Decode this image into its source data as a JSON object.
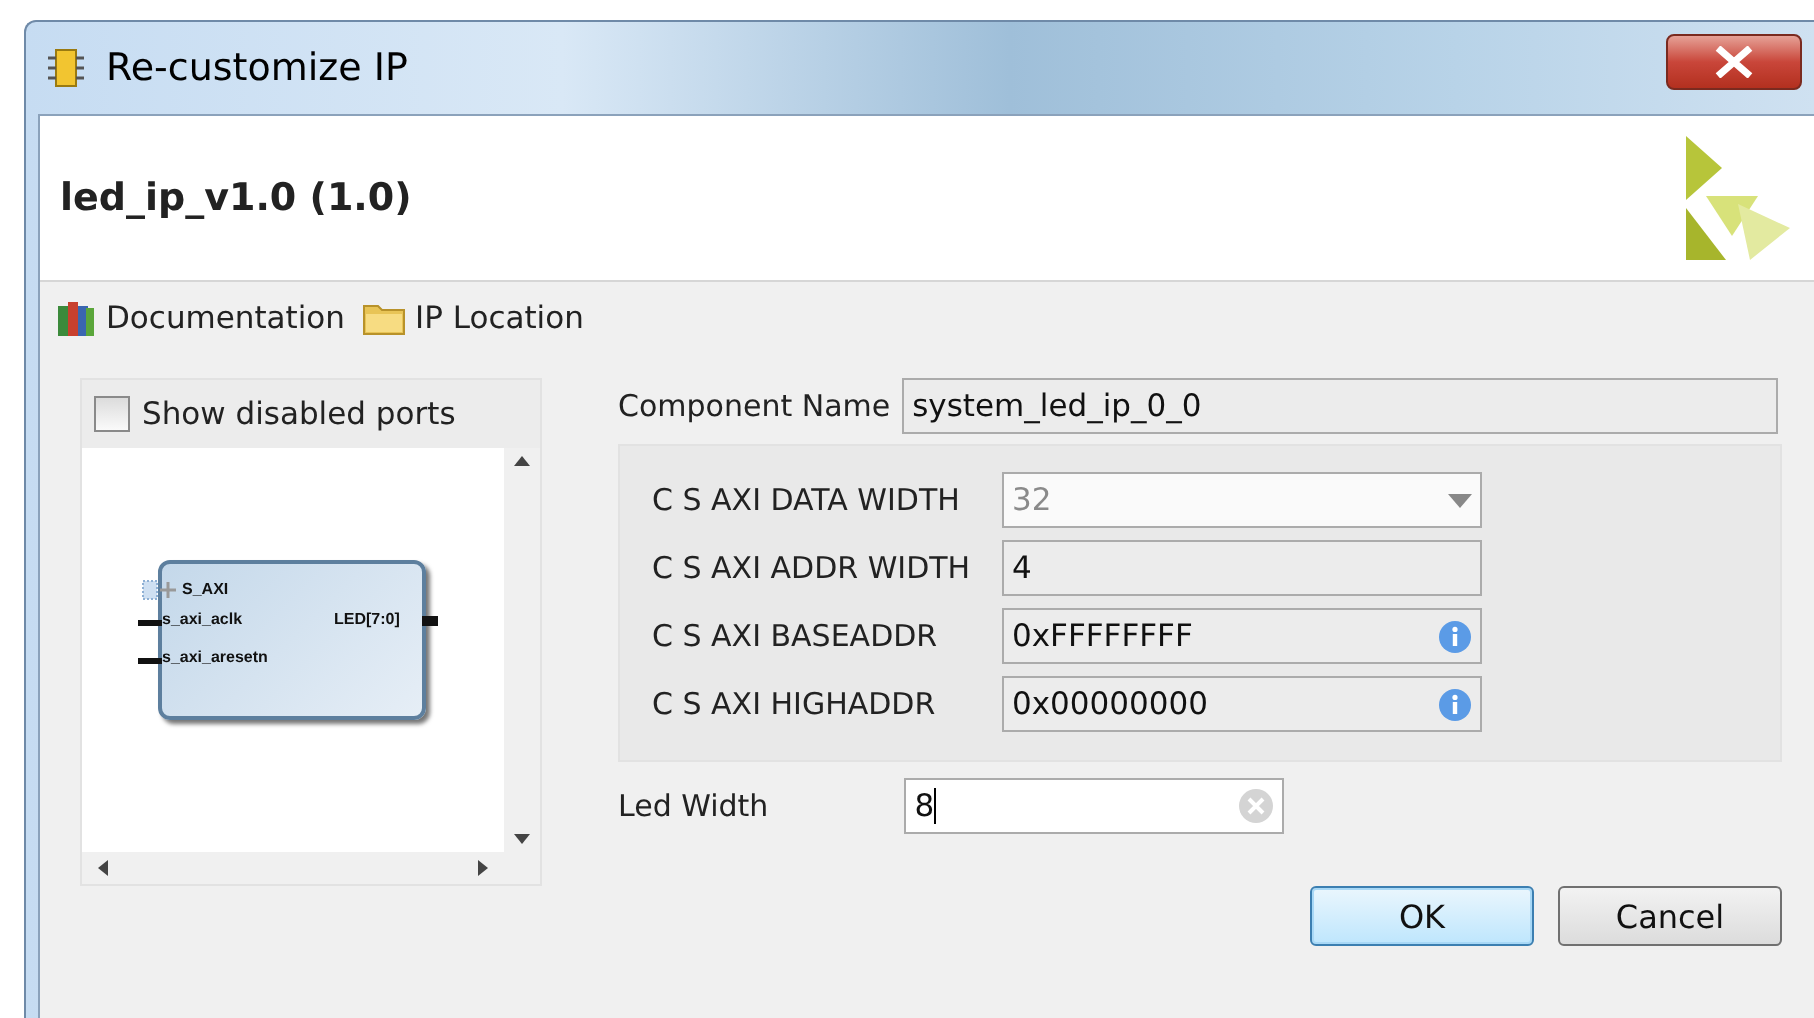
{
  "window": {
    "title": "Re-customize IP"
  },
  "header": {
    "title": "led_ip_v1.0 (1.0)"
  },
  "links": [
    {
      "label": "Documentation",
      "kind": "books"
    },
    {
      "label": "IP Location",
      "kind": "folder"
    }
  ],
  "preview": {
    "show_disabled_ports": {
      "label": "Show disabled ports",
      "checked": false
    },
    "symbol": {
      "bus": "S_AXI",
      "inputs": [
        "s_axi_aclk",
        "s_axi_aresetn"
      ],
      "outputs": [
        "LED[7:0]"
      ]
    }
  },
  "component_name": {
    "label": "Component Name",
    "value": "system_led_ip_0_0"
  },
  "parameters": [
    {
      "label": "C S AXI DATA WIDTH",
      "value": "32",
      "kind": "dropdown",
      "disabled": true,
      "info": false
    },
    {
      "label": "C S AXI ADDR WIDTH",
      "value": "4",
      "kind": "text",
      "disabled": false,
      "info": false
    },
    {
      "label": "C S AXI BASEADDR",
      "value": "0xFFFFFFFF",
      "kind": "text",
      "disabled": false,
      "info": true
    },
    {
      "label": "C S AXI HIGHADDR",
      "value": "0x00000000",
      "kind": "text",
      "disabled": false,
      "info": true
    }
  ],
  "led_width": {
    "label": "Led Width",
    "value": "8"
  },
  "buttons": [
    {
      "label": "OK",
      "kind": "default"
    },
    {
      "label": "Cancel",
      "kind": "normal"
    }
  ]
}
